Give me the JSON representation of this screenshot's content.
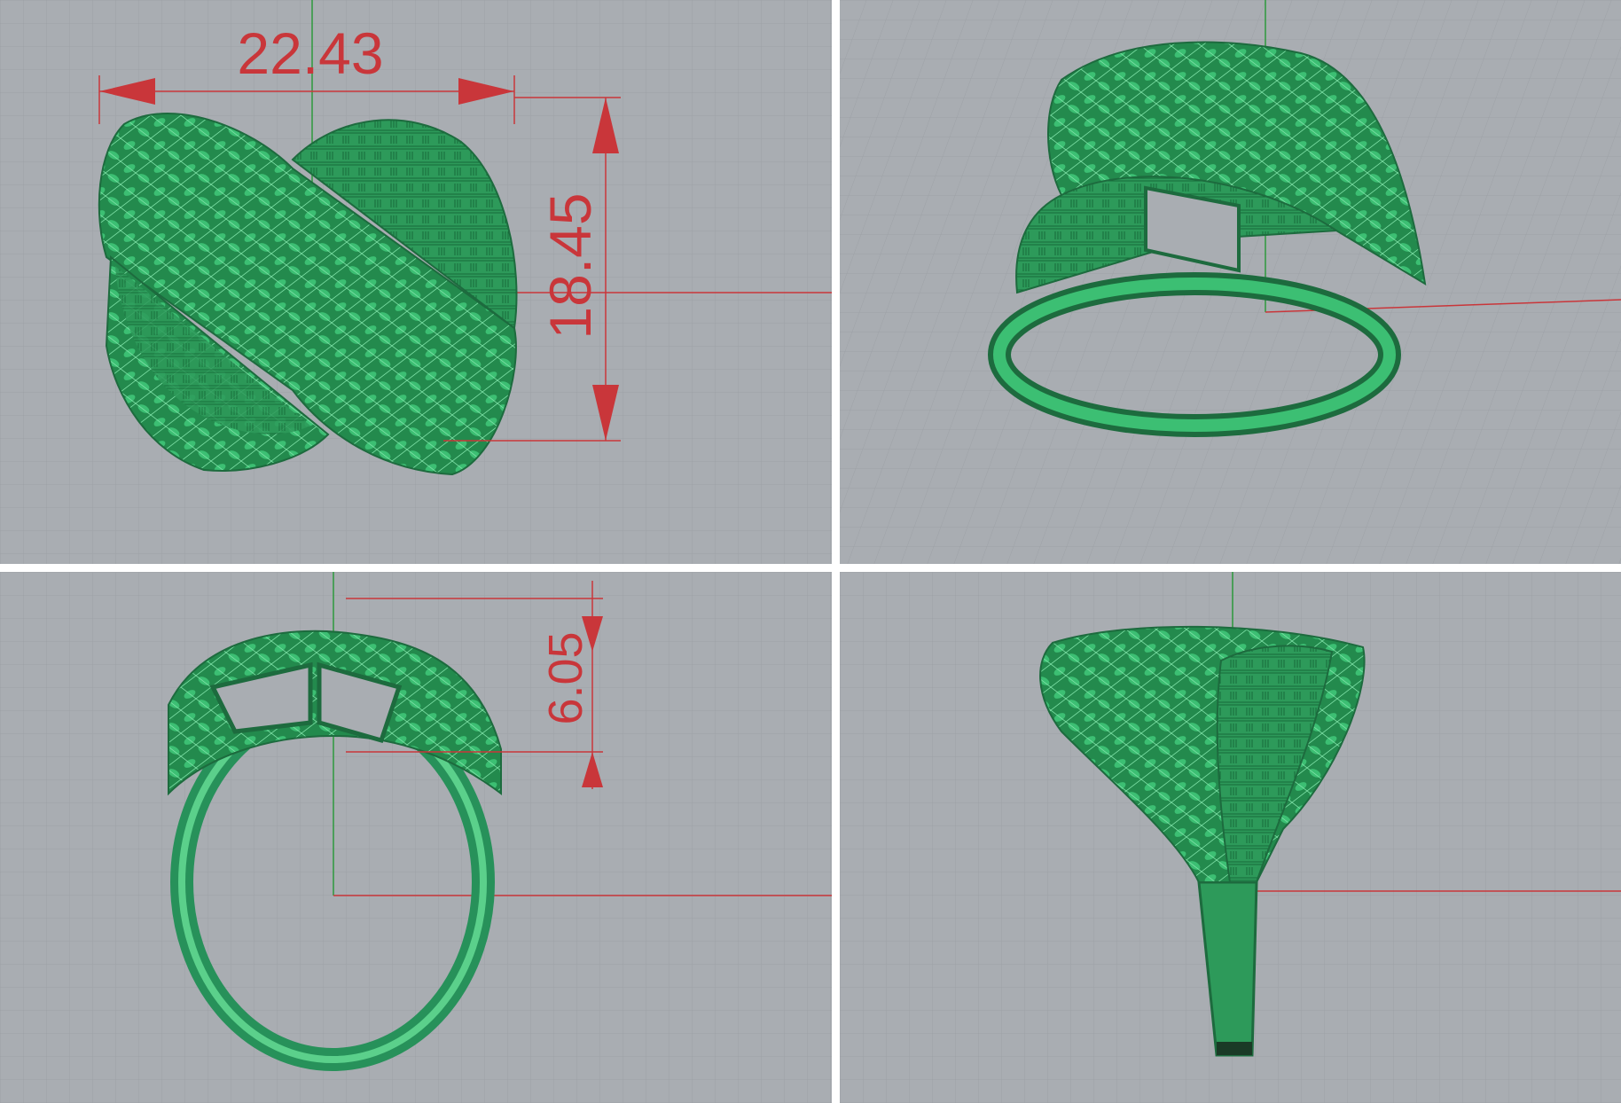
{
  "colors": {
    "background_grid": "#a9adb2",
    "grid_minor": "#9da1a6",
    "grid_major": "#8e9297",
    "axis_x": "#c9363a",
    "axis_y": "#2e9a3c",
    "model_green": "#2f9a5c",
    "model_green_light": "#5bd08b",
    "model_green_dark": "#1d6b3e",
    "dimension": "#c9363a",
    "divider": "#ffffff"
  },
  "viewports": {
    "top": {
      "view": "top",
      "dimensions": [
        "22.43",
        "18.45"
      ]
    },
    "perspective": {
      "view": "perspective",
      "dimensions": []
    },
    "front": {
      "view": "front",
      "dimensions": [
        "6.05"
      ]
    },
    "right": {
      "view": "right",
      "dimensions": []
    }
  },
  "model": {
    "description_icon": "ring-model-icon"
  }
}
